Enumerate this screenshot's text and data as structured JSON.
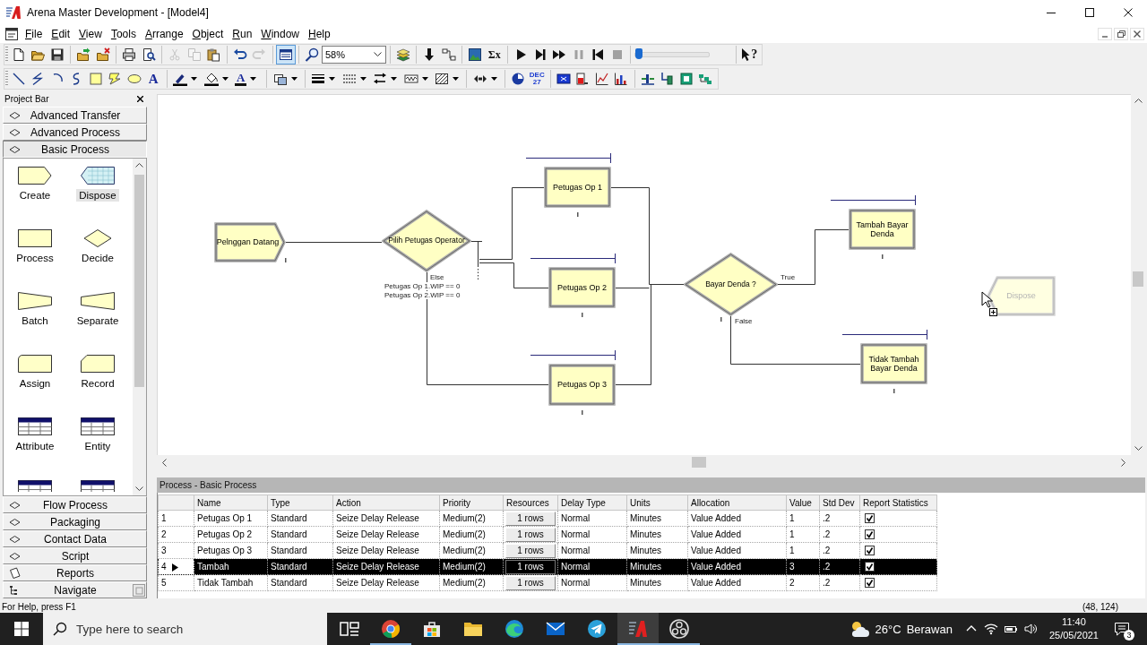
{
  "window": {
    "title": "Arena Master Development - [Model4]"
  },
  "menu": [
    "File",
    "Edit",
    "View",
    "Tools",
    "Arrange",
    "Object",
    "Run",
    "Window",
    "Help"
  ],
  "toolbars": [
    {
      "buttons": [
        {
          "kind": "new",
          "disabled": false,
          "pressed": false
        },
        {
          "kind": "open",
          "disabled": false,
          "pressed": false
        },
        {
          "kind": "save",
          "disabled": false,
          "pressed": false
        },
        {
          "kind": "separator"
        },
        {
          "kind": "attach",
          "disabled": false,
          "pressed": false
        },
        {
          "kind": "detach",
          "disabled": false,
          "pressed": false
        },
        {
          "kind": "separator"
        },
        {
          "kind": "print",
          "disabled": false,
          "pressed": false
        },
        {
          "kind": "preview",
          "disabled": false,
          "pressed": false
        },
        {
          "kind": "separator"
        },
        {
          "kind": "cut",
          "disabled": true,
          "pressed": false
        },
        {
          "kind": "copy",
          "disabled": true,
          "pressed": false
        },
        {
          "kind": "paste",
          "disabled": false,
          "pressed": false
        },
        {
          "kind": "separator"
        },
        {
          "kind": "undo",
          "disabled": false,
          "pressed": false
        },
        {
          "kind": "redo",
          "disabled": true,
          "pressed": false
        },
        {
          "kind": "separator"
        },
        {
          "kind": "layout",
          "disabled": false,
          "pressed": true
        },
        {
          "kind": "separator"
        },
        {
          "kind": "zoom",
          "disabled": false,
          "pressed": false
        },
        {
          "kind": "zoom-combo",
          "value": "58%"
        },
        {
          "kind": "separator"
        },
        {
          "kind": "layers",
          "disabled": false,
          "pressed": false
        },
        {
          "kind": "separator"
        },
        {
          "kind": "submodel",
          "disabled": false,
          "pressed": false
        },
        {
          "kind": "connect",
          "disabled": false,
          "pressed": false
        },
        {
          "kind": "separator"
        },
        {
          "kind": "animate",
          "disabled": false,
          "pressed": false
        },
        {
          "kind": "statistics",
          "glyph": "Σx",
          "disabled": false,
          "pressed": false
        },
        {
          "kind": "separator"
        },
        {
          "kind": "play",
          "disabled": false,
          "pressed": false
        },
        {
          "kind": "step",
          "disabled": false,
          "pressed": false
        },
        {
          "kind": "fast-forward",
          "disabled": false,
          "pressed": false
        },
        {
          "kind": "pause",
          "disabled": true,
          "pressed": false
        },
        {
          "kind": "rewind",
          "disabled": false,
          "pressed": false
        },
        {
          "kind": "stop",
          "disabled": true,
          "pressed": false
        },
        {
          "kind": "separator"
        },
        {
          "kind": "speed-slider",
          "level": 0.05
        },
        {
          "kind": "separator"
        },
        {
          "kind": "help",
          "glyph": "?",
          "disabled": false,
          "pressed": false
        }
      ]
    },
    {
      "buttons": [
        {
          "kind": "line",
          "disabled": false,
          "pressed": false
        },
        {
          "kind": "polyline",
          "disabled": false,
          "pressed": false
        },
        {
          "kind": "arc",
          "disabled": false,
          "pressed": false
        },
        {
          "kind": "curve",
          "disabled": false,
          "pressed": false
        },
        {
          "kind": "rectangle",
          "disabled": false,
          "pressed": false
        },
        {
          "kind": "polygon",
          "disabled": false,
          "pressed": false
        },
        {
          "kind": "ellipse",
          "disabled": false,
          "pressed": false
        },
        {
          "kind": "text-tool",
          "glyph": "A",
          "disabled": false,
          "pressed": false
        },
        {
          "kind": "separator"
        },
        {
          "kind": "line-color",
          "menu": true,
          "disabled": false,
          "pressed": false
        },
        {
          "kind": "fill-color",
          "menu": true,
          "disabled": false,
          "pressed": false
        },
        {
          "kind": "text-color",
          "glyph": "A",
          "menu": true,
          "disabled": false,
          "pressed": false
        },
        {
          "kind": "separator"
        },
        {
          "kind": "window",
          "menu": true,
          "disabled": false,
          "pressed": false
        },
        {
          "kind": "separator"
        },
        {
          "kind": "line-width",
          "menu": true,
          "disabled": false,
          "pressed": false
        },
        {
          "kind": "line-style",
          "menu": true,
          "disabled": false,
          "pressed": false
        },
        {
          "kind": "arrow-style",
          "menu": true,
          "disabled": false,
          "pressed": false
        },
        {
          "kind": "pattern",
          "menu": true,
          "disabled": false,
          "pressed": false
        },
        {
          "kind": "fill-pattern",
          "menu": true,
          "disabled": false,
          "pressed": false
        },
        {
          "kind": "separator"
        },
        {
          "kind": "arrow-scale",
          "menu": true,
          "disabled": false,
          "pressed": false
        },
        {
          "kind": "separator"
        },
        {
          "kind": "clock",
          "disabled": false,
          "pressed": false
        },
        {
          "kind": "date",
          "glyph": "DEC 27",
          "disabled": false,
          "pressed": false
        },
        {
          "kind": "separator"
        },
        {
          "kind": "variable",
          "disabled": false,
          "pressed": false
        },
        {
          "kind": "level",
          "disabled": false,
          "pressed": false
        },
        {
          "kind": "plot",
          "disabled": false,
          "pressed": false
        },
        {
          "kind": "histogram",
          "disabled": false,
          "pressed": false
        },
        {
          "kind": "separator"
        },
        {
          "kind": "station",
          "disabled": false,
          "pressed": false
        },
        {
          "kind": "route",
          "disabled": false,
          "pressed": false
        },
        {
          "kind": "storage",
          "disabled": false,
          "pressed": false
        },
        {
          "kind": "transporter",
          "disabled": false,
          "pressed": false
        }
      ]
    }
  ],
  "project_bar": {
    "title": "Project Bar",
    "panels": [
      {
        "label": "Advanced Transfer",
        "kind": "template",
        "expanded": false
      },
      {
        "label": "Advanced Process",
        "kind": "template",
        "expanded": false
      },
      {
        "label": "Basic Process",
        "kind": "template",
        "expanded": true,
        "modules": [
          {
            "label": "Create",
            "kind": "create",
            "selected": false
          },
          {
            "label": "Dispose",
            "kind": "dispose",
            "selected": true
          },
          {
            "label": "Process",
            "kind": "process",
            "selected": false
          },
          {
            "label": "Decide",
            "kind": "decide",
            "selected": false
          },
          {
            "label": "Batch",
            "kind": "batch",
            "selected": false
          },
          {
            "label": "Separate",
            "kind": "separate",
            "selected": false
          },
          {
            "label": "Assign",
            "kind": "assign",
            "selected": false
          },
          {
            "label": "Record",
            "kind": "record",
            "selected": false
          },
          {
            "label": "Attribute",
            "kind": "table",
            "selected": false
          },
          {
            "label": "Entity",
            "kind": "table",
            "selected": false
          },
          {
            "kind": "table",
            "selected": false
          },
          {
            "kind": "table",
            "selected": false
          }
        ]
      },
      {
        "label": "Flow Process",
        "kind": "template",
        "expanded": false
      },
      {
        "label": "Packaging",
        "kind": "template",
        "expanded": false
      },
      {
        "label": "Contact Data",
        "kind": "template",
        "expanded": false
      },
      {
        "label": "Script",
        "kind": "template",
        "expanded": false
      },
      {
        "label": "Reports",
        "kind": "reports",
        "expanded": false
      },
      {
        "label": "Navigate",
        "kind": "navigate",
        "expanded": false
      }
    ]
  },
  "canvas": {
    "modules": [
      {
        "kind": "create",
        "label": "Pelnggan Datang",
        "dragging": false
      },
      {
        "kind": "decide",
        "label": "Pilih Petugas Operator",
        "branch_labels": [
          "Else"
        ],
        "conditions": [
          "Petugas Op 1.WIP == 0",
          "Petugas Op 2.WIP == 0"
        ],
        "dragging": false
      },
      {
        "kind": "process",
        "label": "Petugas Op 1",
        "dragging": false
      },
      {
        "kind": "process",
        "label": "Petugas Op 2",
        "dragging": false
      },
      {
        "kind": "process",
        "label": "Petugas Op 3",
        "dragging": false
      },
      {
        "kind": "decide",
        "label": "Bayar Denda ?",
        "branch_labels": [
          "True",
          "False"
        ],
        "dragging": false
      },
      {
        "kind": "process",
        "label": "Tambah Bayar Denda",
        "dragging": false
      },
      {
        "kind": "process",
        "label": "Tidak Tambah Bayar Denda",
        "dragging": false
      },
      {
        "kind": "dispose",
        "label": "Dispose",
        "dragging": true
      }
    ]
  },
  "spreadsheet": {
    "title": "Process - Basic Process",
    "columns": [
      "Name",
      "Type",
      "Action",
      "Priority",
      "Resources",
      "Delay Type",
      "Units",
      "Allocation",
      "Value",
      "Std Dev",
      "Report Statistics"
    ],
    "rows": [
      {
        "selected": false,
        "number": "1",
        "name": "Petugas Op 1",
        "type": "Standard",
        "action": "Seize Delay Release",
        "priority": "Medium(2)",
        "resources": "1 rows",
        "delay_type": "Normal",
        "units": "Minutes",
        "allocation": "Value Added",
        "value": "1",
        "std_dev": ".2",
        "report_statistics": true
      },
      {
        "selected": false,
        "number": "2",
        "name": "Petugas Op 2",
        "type": "Standard",
        "action": "Seize Delay Release",
        "priority": "Medium(2)",
        "resources": "1 rows",
        "delay_type": "Normal",
        "units": "Minutes",
        "allocation": "Value Added",
        "value": "1",
        "std_dev": ".2",
        "report_statistics": true
      },
      {
        "selected": false,
        "number": "3",
        "name": "Petugas Op 3",
        "type": "Standard",
        "action": "Seize Delay Release",
        "priority": "Medium(2)",
        "resources": "1 rows",
        "delay_type": "Normal",
        "units": "Minutes",
        "allocation": "Value Added",
        "value": "1",
        "std_dev": ".2",
        "report_statistics": true
      },
      {
        "selected": true,
        "number": "4",
        "name": "Tambah",
        "type": "Standard",
        "action": "Seize Delay Release",
        "priority": "Medium(2)",
        "resources": "1 rows",
        "delay_type": "Normal",
        "units": "Minutes",
        "allocation": "Value Added",
        "value": "3",
        "std_dev": ".2",
        "report_statistics": true
      },
      {
        "selected": false,
        "number": "5",
        "name": "Tidak Tambah",
        "type": "Standard",
        "action": "Seize Delay Release",
        "priority": "Medium(2)",
        "resources": "1 rows",
        "delay_type": "Normal",
        "units": "Minutes",
        "allocation": "Value Added",
        "value": "2",
        "std_dev": ".2",
        "report_statistics": true
      }
    ]
  },
  "status_bar": {
    "help": "For Help, press F1",
    "coordinates": "(48, 124)"
  },
  "taskbar": {
    "search": {
      "placeholder": "Type here to search"
    },
    "apps": [
      {
        "kind": "task-view",
        "running": false,
        "selected": false
      },
      {
        "kind": "circle-browser",
        "running": true,
        "selected": false
      },
      {
        "kind": "store",
        "running": false,
        "selected": false
      },
      {
        "kind": "files",
        "running": false,
        "selected": false
      },
      {
        "kind": "wave-browser",
        "running": false,
        "selected": false
      },
      {
        "kind": "mail",
        "running": false,
        "selected": false
      },
      {
        "kind": "messenger",
        "running": false,
        "selected": false
      },
      {
        "kind": "modeler",
        "running": true,
        "selected": true
      },
      {
        "kind": "recorder",
        "running": true,
        "selected": false
      }
    ],
    "weather": {
      "temperature": "26°C",
      "condition": "Berawan"
    },
    "clock": {
      "time": "11:40",
      "date": "25/05/2021"
    },
    "notifications": {
      "count": "3"
    }
  }
}
